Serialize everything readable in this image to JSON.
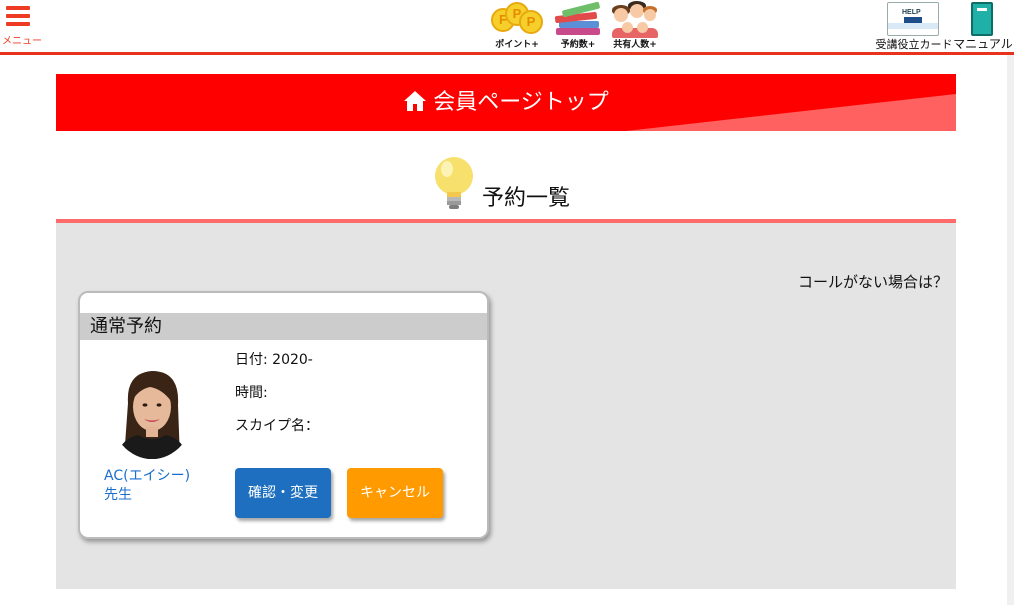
{
  "header": {
    "menu_label": "メニュー",
    "icons": {
      "points_label": "ポイント+",
      "reservations_label": "予約数+",
      "shared_people_label": "共有人数+",
      "help_card_label": "受講役立カード",
      "help_card_text": "HELP",
      "manual_label": "マニュアル"
    },
    "accent_color": "#e8321c"
  },
  "banner": {
    "title": "会員ページトップ",
    "icon": "home-icon",
    "color": "#ff0000"
  },
  "section": {
    "title": "予約一覧",
    "icon": "lightbulb-icon"
  },
  "content": {
    "no_call_link": "コールがない場合は？"
  },
  "reservation_card": {
    "type_label": "通常予約",
    "teacher_name": "AC(エイシー)",
    "teacher_suffix": "先生",
    "date_label": "日付: 2020-",
    "time_label": "時間:",
    "skype_label": "スカイプ名：",
    "confirm_button": "確認・変更",
    "cancel_button": "キャンセル",
    "confirm_color": "#1e6fbf",
    "cancel_color": "#ff9a00"
  }
}
